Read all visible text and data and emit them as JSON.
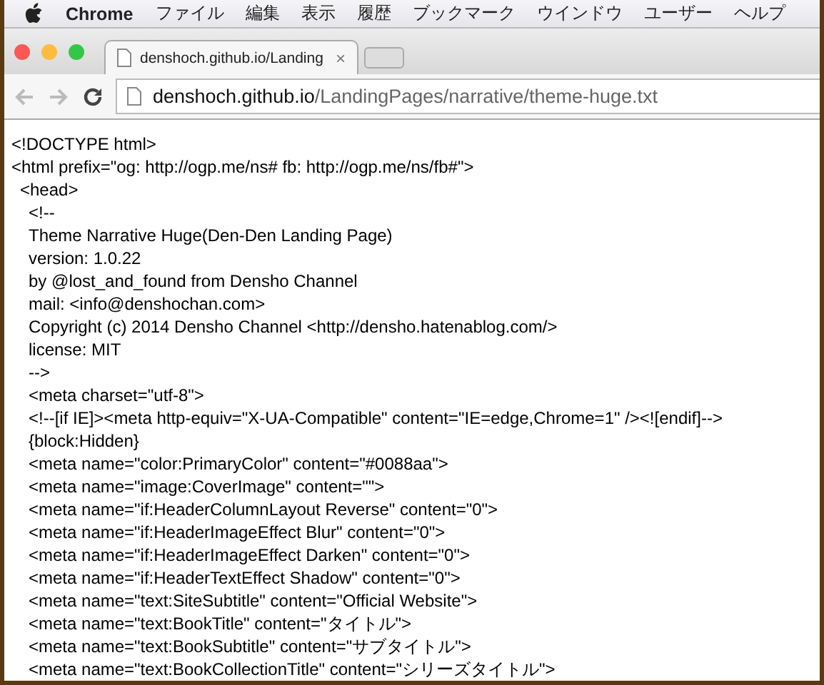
{
  "menu_bar": {
    "app_name": "Chrome",
    "items": [
      "ファイル",
      "編集",
      "表示",
      "履歴",
      "ブックマーク",
      "ウインドウ",
      "ユーザー",
      "ヘルプ"
    ]
  },
  "tabs": [
    {
      "kind": "page",
      "title": "denshoch.github.io/Landing",
      "close": "×",
      "selected": true
    },
    {
      "kind": "new",
      "selected": false
    }
  ],
  "address_bar": {
    "host": "denshoch.github.io",
    "path": "/LandingPages/narrative/theme-huge.txt"
  },
  "document": {
    "lines": [
      {
        "text": "<!DOCTYPE html>"
      },
      {
        "text": "<html prefix=\"og: http://ogp.me/ns# fb: http://ogp.me/ns/fb#\">",
        "children": [
          {
            "text": "<head>",
            "children": [
              {
                "text": "<!--"
              },
              {
                "text": "Theme Narrative Huge(Den-Den Landing Page)"
              },
              {
                "text": "version: 1.0.22"
              },
              {
                "text": "by @lost_and_found from Densho Channel"
              },
              {
                "text": "mail: <info@denshochan.com>"
              },
              {
                "text": "Copyright (c) 2014 Densho Channel <http://densho.hatenablog.com/>"
              },
              {
                "text": "license: MIT"
              },
              {
                "text": "-->"
              },
              {
                "text": "<meta charset=\"utf-8\">"
              },
              {
                "text": "<!--[if IE]><meta http-equiv=\"X-UA-Compatible\" content=\"IE=edge,Chrome=1\" /><![endif]-->"
              },
              {
                "text": "{block:Hidden}"
              },
              {
                "text": "<meta name=\"color:PrimaryColor\" content=\"#0088aa\">"
              },
              {
                "text": "<meta name=\"image:CoverImage\" content=\"\">"
              },
              {
                "text": "<meta name=\"if:HeaderColumnLayout Reverse\" content=\"0\">"
              },
              {
                "text": "<meta name=\"if:HeaderImageEffect Blur\" content=\"0\">"
              },
              {
                "text": "<meta name=\"if:HeaderImageEffect Darken\" content=\"0\">"
              },
              {
                "text": "<meta name=\"if:HeaderTextEffect Shadow\" content=\"0\">"
              },
              {
                "text": "<meta name=\"text:SiteSubtitle\" content=\"Official Website\">"
              },
              {
                "text": "<meta name=\"text:BookTitle\" content=\"タイトル\">"
              },
              {
                "text": "<meta name=\"text:BookSubtitle\" content=\"サブタイトル\">"
              },
              {
                "text": "<meta name=\"text:BookCollectionTitle\" content=\"シリーズタイトル\">"
              }
            ]
          }
        ]
      }
    ]
  }
}
